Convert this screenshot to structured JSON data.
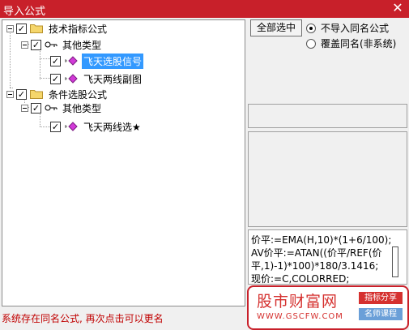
{
  "window": {
    "title": "导入公式",
    "close_glyph": "✕"
  },
  "tree": {
    "group1": {
      "label": "技术指标公式",
      "subgroup": {
        "label": "其他类型",
        "items": [
          {
            "label": "飞天选股信号",
            "selected": true
          },
          {
            "label": "飞天两线副图",
            "selected": false
          }
        ]
      }
    },
    "group2": {
      "label": "条件选股公式",
      "subgroup": {
        "label": "其他类型",
        "items": [
          {
            "label": "飞天两线选★",
            "selected": false
          }
        ]
      }
    },
    "check_glyph": "✓"
  },
  "options": {
    "select_all_label": "全部选中",
    "radio_no_import": "不导入同名公式",
    "radio_overwrite": "覆盖同名(非系统)",
    "selected": "no_import"
  },
  "code": {
    "lines": [
      "价平:=EMA(H,10)*(1+6/100);",
      "AV价平:=ATAN((价平/REF(价",
      "平,1)-1)*100)*180/3.1416;",
      "现价:=C,COLORRED;"
    ]
  },
  "status": {
    "message": "系统存在同名公式, 再次点击可以更名"
  },
  "watermark": {
    "brand": "股市财富网",
    "url": "WWW.GSCFW.COM",
    "tag1": "指标分享",
    "tag2": "名师课程"
  },
  "colors": {
    "titlebar": "#c8202a",
    "selection": "#3399ff",
    "status_text": "#c00000",
    "brand_red": "#d5312f"
  }
}
